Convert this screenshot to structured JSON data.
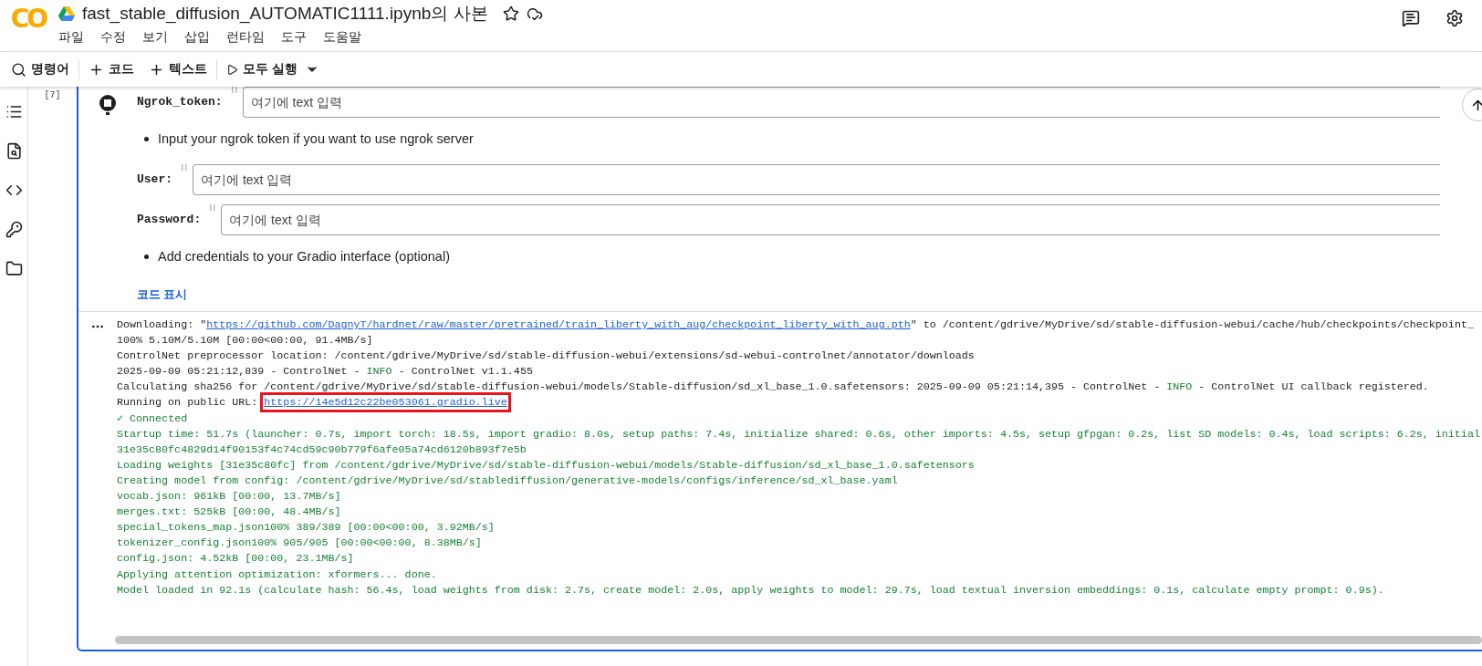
{
  "app": {
    "logo": "CO",
    "title": "fast_stable_diffusion_AUTOMATIC1111.ipynb의 사본"
  },
  "menu": [
    "파일",
    "수정",
    "보기",
    "삽입",
    "런타임",
    "도구",
    "도움말"
  ],
  "toolbar": [
    {
      "kind": "search",
      "label": "명령어"
    },
    {
      "kind": "add",
      "label": "코드"
    },
    {
      "kind": "add",
      "label": "텍스트"
    },
    {
      "kind": "run",
      "label": "모두 실행"
    }
  ],
  "cell": {
    "execution_count": "[7]",
    "form": [
      {
        "kind": "field",
        "label": "Ngrok_token:",
        "placeholder": "여기에 text 입력"
      },
      {
        "kind": "note",
        "text": "Input your ngrok token if you want to use ngrok server"
      },
      {
        "kind": "field",
        "label": "User:",
        "placeholder": "여기에 text 입력"
      },
      {
        "kind": "field",
        "label": "Password:",
        "placeholder": "여기에 text 입력"
      },
      {
        "kind": "note",
        "text": "Add credentials to your Gradio interface (optional)"
      }
    ],
    "show_code": "코드 표시",
    "output": [
      {
        "kind": "log",
        "segments": [
          {
            "kind": "text",
            "text": "Downloading: \""
          },
          {
            "kind": "link",
            "text": "https://github.com/DagnyT/hardnet/raw/master/pretrained/train_liberty_with_aug/checkpoint_liberty_with_aug.pth"
          },
          {
            "kind": "text",
            "text": "\" to /content/gdrive/MyDrive/sd/stable-diffusion-webui/cache/hub/checkpoints/checkpoint_"
          }
        ]
      },
      {
        "kind": "log",
        "segments": [
          {
            "kind": "text",
            "text": "100% 5.10M/5.10M [00:00<00:00, 91.4MB/s]"
          }
        ]
      },
      {
        "kind": "log",
        "segments": [
          {
            "kind": "text",
            "text": "ControlNet preprocessor location: /content/gdrive/MyDrive/sd/stable-diffusion-webui/extensions/sd-webui-controlnet/annotator/downloads"
          }
        ]
      },
      {
        "kind": "log",
        "segments": [
          {
            "kind": "text",
            "text": "2025-09-09 05:21:12,839 - ControlNet - "
          },
          {
            "kind": "info",
            "text": "INFO"
          },
          {
            "kind": "text",
            "text": " - ControlNet v1.1.455"
          }
        ]
      },
      {
        "kind": "log",
        "segments": [
          {
            "kind": "text",
            "text": "Calculating sha256 for /content/gdrive/MyDrive/sd/stable-diffusion-webui/models/Stable-diffusion/sd_xl_base_1.0.safetensors: 2025-09-09 05:21:14,395 - ControlNet - "
          },
          {
            "kind": "info",
            "text": "INFO"
          },
          {
            "kind": "text",
            "text": " - ControlNet UI callback registered."
          }
        ]
      },
      {
        "kind": "log",
        "segments": [
          {
            "kind": "text",
            "text": "Running on public URL: "
          },
          {
            "kind": "link",
            "text": "https://14e5d12c22be053061.gradio.live",
            "boxed": true
          }
        ]
      },
      {
        "kind": "success",
        "segments": [
          {
            "kind": "text",
            "text": "✓ Connected"
          }
        ]
      },
      {
        "kind": "success",
        "segments": [
          {
            "kind": "text",
            "text": "Startup time: 51.7s (launcher: 0.7s, import torch: 18.5s, import gradio: 8.0s, setup paths: 7.4s, initialize shared: 0.6s, other imports: 4.5s, setup gfpgan: 0.2s, list SD models: 0.4s, load scripts: 6.2s, initial"
          }
        ]
      },
      {
        "kind": "success",
        "segments": [
          {
            "kind": "text",
            "text": "31e35c80fc4829d14f90153f4c74cd59c90b779f6afe05a74cd6120b893f7e5b"
          }
        ]
      },
      {
        "kind": "success",
        "segments": [
          {
            "kind": "text",
            "text": "Loading weights [31e35c80fc] from /content/gdrive/MyDrive/sd/stable-diffusion-webui/models/Stable-diffusion/sd_xl_base_1.0.safetensors"
          }
        ]
      },
      {
        "kind": "success",
        "segments": [
          {
            "kind": "text",
            "text": "Creating model from config: /content/gdrive/MyDrive/sd/stablediffusion/generative-models/configs/inference/sd_xl_base.yaml"
          }
        ]
      },
      {
        "kind": "success",
        "segments": [
          {
            "kind": "text",
            "text": "vocab.json: 961kB [00:00, 13.7MB/s]"
          }
        ]
      },
      {
        "kind": "success",
        "segments": [
          {
            "kind": "text",
            "text": "merges.txt: 525kB [00:00, 48.4MB/s]"
          }
        ]
      },
      {
        "kind": "success",
        "segments": [
          {
            "kind": "text",
            "text": "special_tokens_map.json100% 389/389 [00:00<00:00, 3.92MB/s]"
          }
        ]
      },
      {
        "kind": "success",
        "segments": [
          {
            "kind": "text",
            "text": "tokenizer_config.json100% 905/905 [00:00<00:00, 8.38MB/s]"
          }
        ]
      },
      {
        "kind": "success",
        "segments": [
          {
            "kind": "text",
            "text": "config.json: 4.52kB [00:00, 23.1MB/s]"
          }
        ]
      },
      {
        "kind": "success",
        "segments": [
          {
            "kind": "text",
            "text": "Applying attention optimization: xformers... done."
          }
        ]
      },
      {
        "kind": "success",
        "segments": [
          {
            "kind": "text",
            "text": "Model loaded in 92.1s (calculate hash: 56.4s, load weights from disk: 2.7s, create model: 2.0s, apply weights to model: 29.7s, load textual inversion embeddings: 0.1s, calculate empty prompt: 0.9s)."
          }
        ]
      }
    ]
  }
}
